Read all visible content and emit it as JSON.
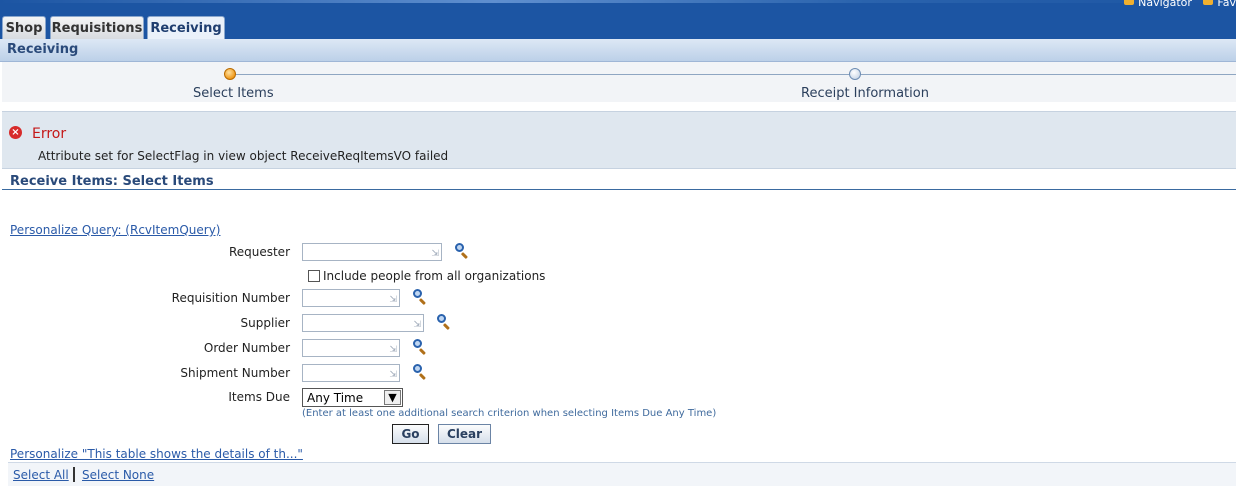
{
  "header": {
    "global_links": [
      "Navigator",
      "Fav"
    ],
    "tabs": [
      {
        "label": "Shop",
        "active": false
      },
      {
        "label": "Requisitions",
        "active": false
      },
      {
        "label": "Receiving",
        "active": true
      }
    ],
    "subtab": "Receiving"
  },
  "train": {
    "steps": [
      {
        "label": "Select Items",
        "state": "current"
      },
      {
        "label": "Receipt Information",
        "state": "pending"
      }
    ]
  },
  "error": {
    "title": "Error",
    "message": "Attribute set for SelectFlag in view object ReceiveReqItemsVO failed",
    "icon": "error-x-icon"
  },
  "section": {
    "title": "Receive Items: Select Items",
    "personalize_query": "Personalize Query: (RcvItemQuery)"
  },
  "form": {
    "requester": {
      "label": "Requester",
      "value": ""
    },
    "include_all_orgs": {
      "label": "Include people from all organizations",
      "checked": false
    },
    "requisition_number": {
      "label": "Requisition Number",
      "value": ""
    },
    "supplier": {
      "label": "Supplier",
      "value": ""
    },
    "order_number": {
      "label": "Order Number",
      "value": ""
    },
    "shipment_number": {
      "label": "Shipment Number",
      "value": ""
    },
    "items_due": {
      "label": "Items Due",
      "selected": "Any Time"
    },
    "hint": "(Enter at least one additional search criterion when selecting Items Due Any Time)"
  },
  "buttons": {
    "go": "Go",
    "clear": "Clear"
  },
  "table": {
    "personalize": "Personalize \"This table shows the details of th...\"",
    "select_all": "Select All",
    "select_none": "Select None"
  },
  "colors": {
    "brand_blue": "#1c55a3",
    "error_red": "#c41818",
    "link": "#2a5aa8",
    "current_step": "#f09a1c"
  }
}
